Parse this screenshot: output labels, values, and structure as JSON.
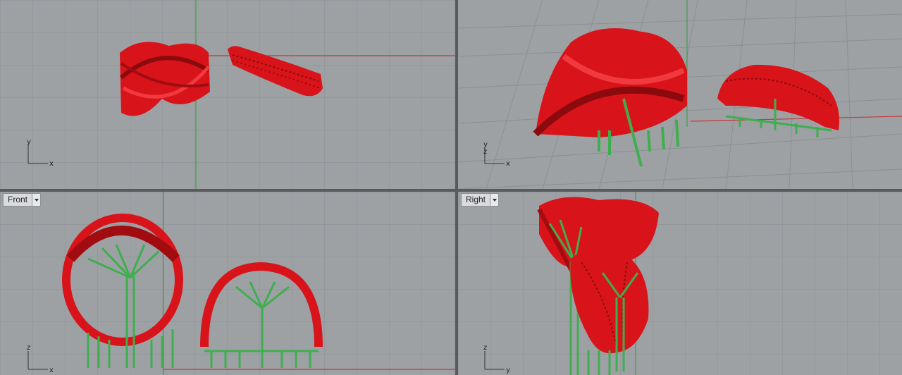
{
  "viewports": {
    "top": {
      "axis_x": "x",
      "axis_y": "y"
    },
    "perspective": {
      "axis_x": "x",
      "axis_y": "y",
      "axis_z": "z"
    },
    "front": {
      "title": "Front",
      "axis_x": "x",
      "axis_y": "z"
    },
    "right": {
      "title": "Right",
      "axis_x": "y",
      "axis_y": "z"
    }
  },
  "colors": {
    "model": "#d8141a",
    "supports": "#3fae4f",
    "viewport_bg": "#9ea1a4",
    "grid": "#8c8f93",
    "x_axis": "#c03a3a",
    "y_axis": "#3aa04a"
  }
}
